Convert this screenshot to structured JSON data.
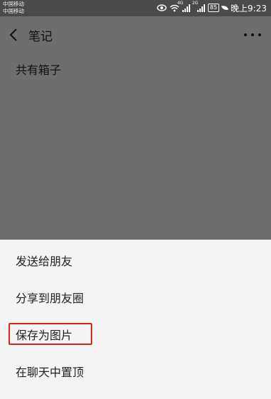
{
  "status_bar": {
    "carrier_1": "中国移动",
    "carrier_2": "中国移动",
    "signal_1_label": "4G",
    "signal_2_label": "2G",
    "battery": "85",
    "time": "晚上9:23"
  },
  "header": {
    "title": "笔记"
  },
  "note": {
    "content": "共有箱子"
  },
  "menu": {
    "items": [
      {
        "label": "发送给朋友"
      },
      {
        "label": "分享到朋友圈"
      },
      {
        "label": "保存为图片"
      },
      {
        "label": "在聊天中置顶"
      }
    ]
  },
  "colors": {
    "highlight": "#d9251d",
    "overlay": "#6e6e6e",
    "sheet": "#f4f4f4"
  }
}
